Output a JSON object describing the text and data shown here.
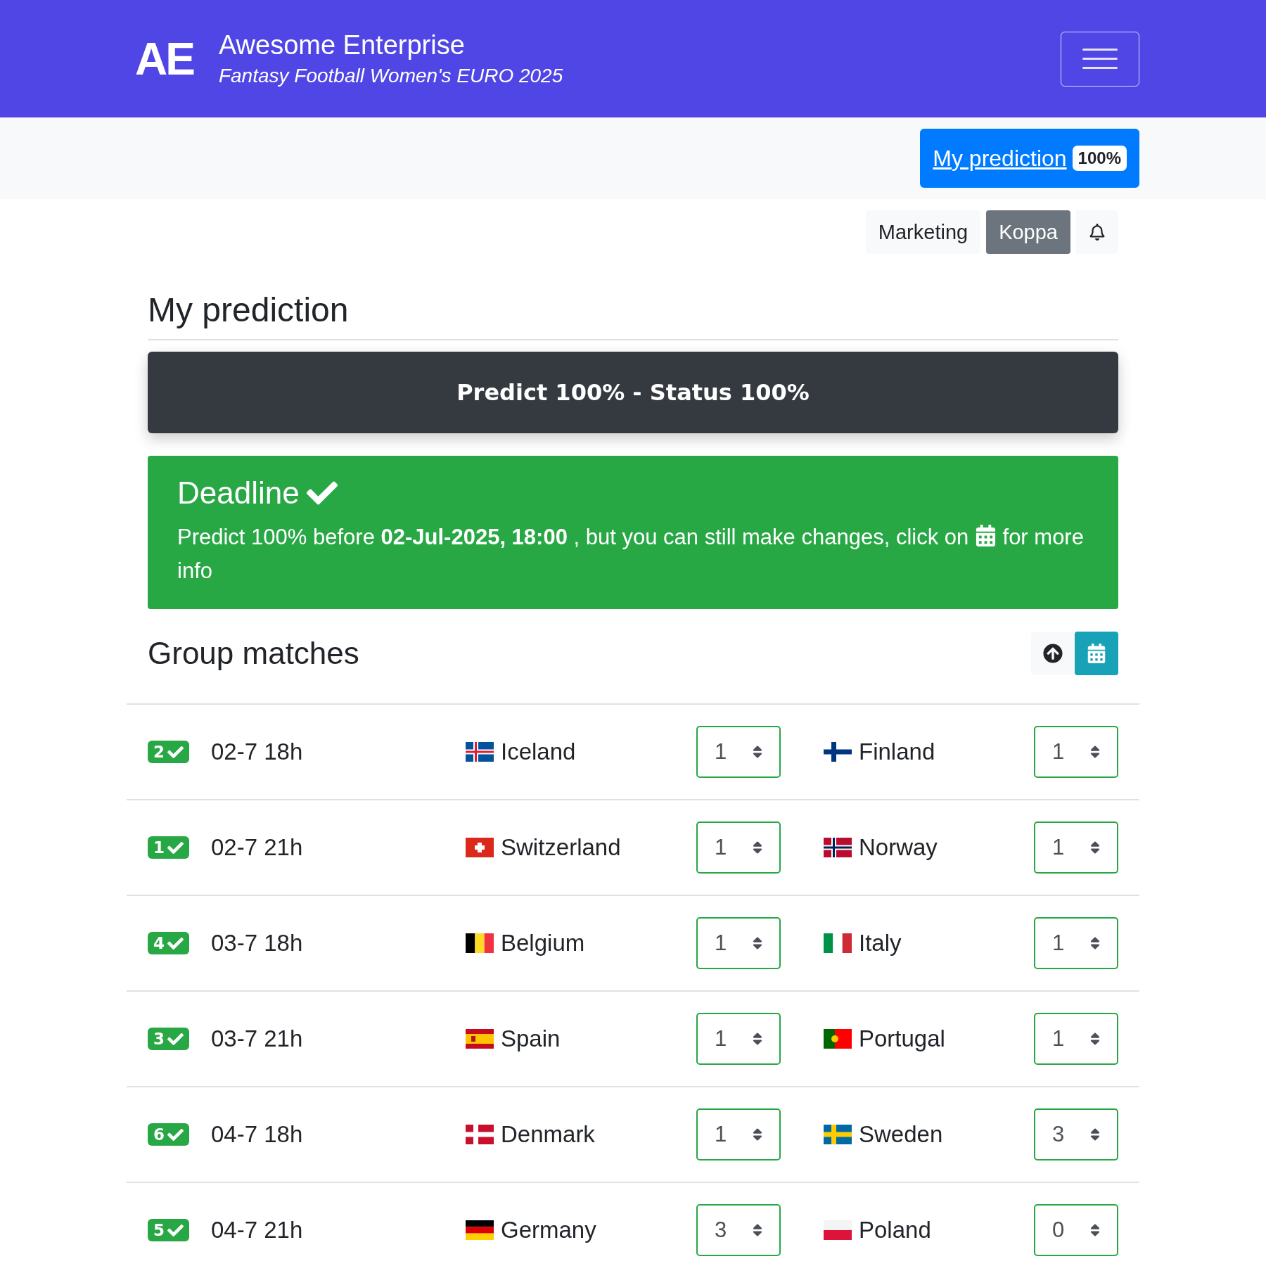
{
  "header": {
    "logo": "AE",
    "title": "Awesome Enterprise",
    "subtitle": "Fantasy Football Women's EURO 2025"
  },
  "prediction_button": {
    "label": "My prediction",
    "badge": "100%"
  },
  "user_bar": {
    "buttons": [
      {
        "label": "Marketing",
        "selected": false
      },
      {
        "label": "Koppa",
        "selected": true
      }
    ]
  },
  "page_title": "My prediction",
  "status_bar": "Predict 100% - Status 100%",
  "deadline": {
    "title": "Deadline",
    "text_before": "Predict 100% before **02-Jul-2025, 18:00** , but you can still make changes, click on",
    "text_after": "for more info"
  },
  "section_title": "Group matches",
  "matches": [
    {
      "count": "2",
      "date": "02-7 18h",
      "home": {
        "name": "Iceland",
        "kind": "is"
      },
      "home_score": "1",
      "away": {
        "name": "Finland",
        "kind": "fi"
      },
      "away_score": "1"
    },
    {
      "count": "1",
      "date": "02-7 21h",
      "home": {
        "name": "Switzerland",
        "kind": "ch"
      },
      "home_score": "1",
      "away": {
        "name": "Norway",
        "kind": "no"
      },
      "away_score": "1"
    },
    {
      "count": "4",
      "date": "03-7 18h",
      "home": {
        "name": "Belgium",
        "kind": "be"
      },
      "home_score": "1",
      "away": {
        "name": "Italy",
        "kind": "it"
      },
      "away_score": "1"
    },
    {
      "count": "3",
      "date": "03-7 21h",
      "home": {
        "name": "Spain",
        "kind": "es"
      },
      "home_score": "1",
      "away": {
        "name": "Portugal",
        "kind": "pt"
      },
      "away_score": "1"
    },
    {
      "count": "6",
      "date": "04-7 18h",
      "home": {
        "name": "Denmark",
        "kind": "dk"
      },
      "home_score": "1",
      "away": {
        "name": "Sweden",
        "kind": "se"
      },
      "away_score": "3"
    },
    {
      "count": "5",
      "date": "04-7 21h",
      "home": {
        "name": "Germany",
        "kind": "de"
      },
      "home_score": "3",
      "away": {
        "name": "Poland",
        "kind": "pl"
      },
      "away_score": "0"
    }
  ]
}
